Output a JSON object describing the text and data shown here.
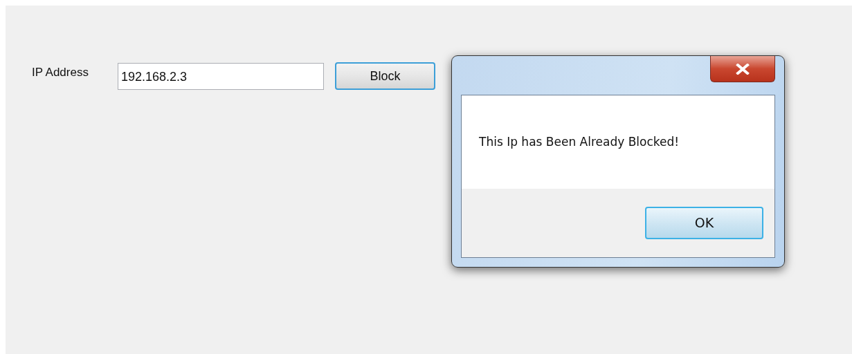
{
  "form": {
    "ip_label": "IP Address",
    "ip_value": "192.168.2.3",
    "block_button": "Block"
  },
  "dialog": {
    "message": "This Ip has Been Already Blocked!",
    "ok_button": "OK"
  }
}
